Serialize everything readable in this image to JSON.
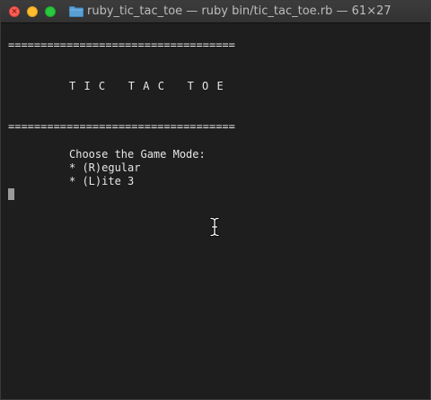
{
  "window": {
    "title": "ruby_tic_tac_toe — ruby bin/tic_tac_toe.rb — 61×27",
    "close_glyph": "×"
  },
  "terminal": {
    "separator_top": "===================================",
    "heading": "T I C   T A C   T O E",
    "separator_bottom": "===================================",
    "prompt": "Choose the Game Mode:",
    "options": [
      "* (R)egular",
      "* (L)ite 3"
    ]
  },
  "colors": {
    "terminal_background": "#1e1e1e",
    "terminal_text": "#e6e6e6",
    "titlebar": "#323232",
    "close": "#fe5f57",
    "minimize": "#febc2e",
    "zoom": "#28c840",
    "folder": "#5a9fd4"
  },
  "icons": {
    "title_icon": "folder-icon",
    "pointer": "ibeam-cursor-icon"
  }
}
